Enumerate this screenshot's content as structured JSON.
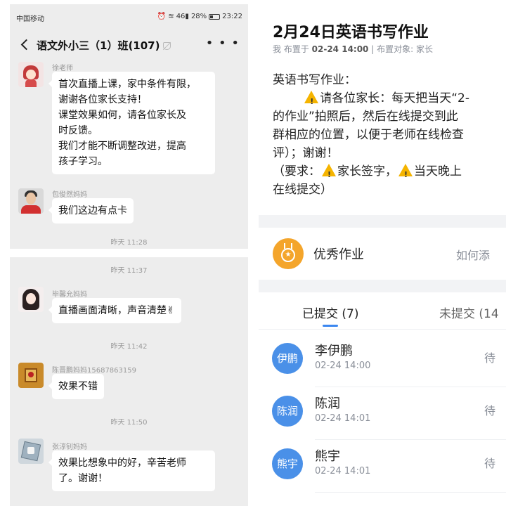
{
  "chat": {
    "status": {
      "carrier": "中国移动",
      "battery": "28%",
      "time": "23:22",
      "signal_text": "46"
    },
    "title": "语文外小三（1）班(107)",
    "messages": [
      {
        "sender": "徐老师",
        "lines": [
          "首次直播上课，家中条件有限，",
          "谢谢各位家长支持！",
          "课堂效果如何，请各位家长及",
          "时反馈。",
          "我们才能不断调整改进，提高",
          "孩子学习。"
        ]
      },
      {
        "sender": "包俊然妈妈",
        "lines": [
          "我们这边有点卡"
        ]
      }
    ],
    "timestamps": [
      "昨天 11:28",
      "昨天 11:37",
      "昨天 11:42",
      "昨天 11:50"
    ],
    "messages2": [
      {
        "sender": "毕馨允妈妈",
        "text": "直播画面清晰，声音清楚✌"
      },
      {
        "sender": "陈晋鹏妈妈15687863159",
        "text": "效果不错"
      },
      {
        "sender": "张淳钊妈妈",
        "lines": [
          "效果比想象中的好，辛苦老师",
          "了。谢谢！"
        ]
      }
    ]
  },
  "homework": {
    "title": "2月24日英语书写作业",
    "meta": {
      "prefix": "我 布置于",
      "date": "02-24 14:00",
      "sep": "|",
      "target": "布置对象: 家长"
    },
    "body": {
      "line1": "英语书写作业：",
      "line2_pre": "        ",
      "line2": "请各位家长：每天把当天“2-",
      "line3": "的作业”拍照后，然后在线提交到此",
      "line4": "群相应的位置，以便于老师在线检查",
      "line5": "评）；谢谢！",
      "line6_a": "（要求：",
      "line6_b": "家长签字，",
      "line6_c": "当天晚上",
      "line7": "在线提交）"
    },
    "excellent": {
      "label": "优秀作业",
      "action": "如何添"
    },
    "tabs": {
      "submitted": "已提交 (7)",
      "pending": "未提交 (14"
    },
    "submissions": [
      {
        "avatar": "伊鹏",
        "name": "李伊鹏",
        "time": "02-24 14:00",
        "status": "待"
      },
      {
        "avatar": "陈润",
        "name": "陈润",
        "time": "02-24 14:01",
        "status": "待"
      },
      {
        "avatar": "熊宇",
        "name": "熊宇",
        "time": "02-24 14:01",
        "status": "待"
      }
    ],
    "colors": {
      "accent": "#4a90e8",
      "medal": "#f4a52b",
      "warning": "#f5b400"
    }
  }
}
